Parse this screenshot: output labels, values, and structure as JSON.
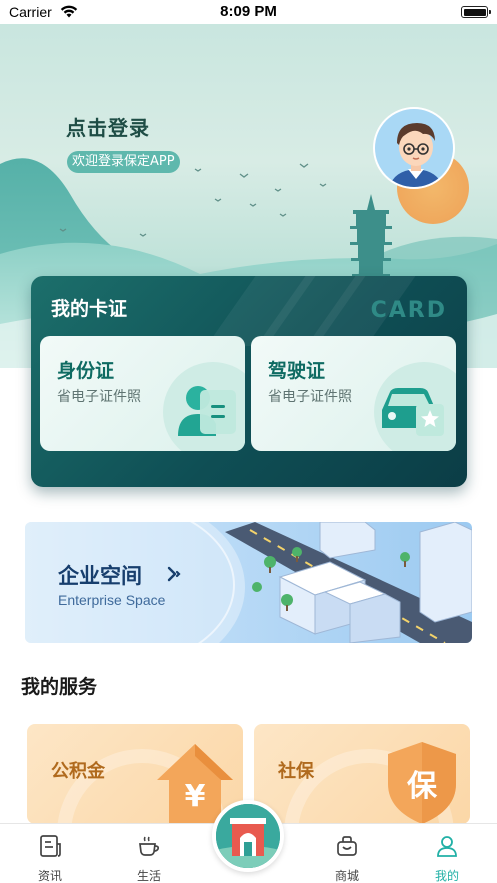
{
  "status_bar": {
    "carrier": "Carrier",
    "time": "8:09 PM"
  },
  "header": {
    "login_title": "点击登录",
    "welcome_text": "欢迎登录保定APP"
  },
  "cards": {
    "section_title": "我的卡证",
    "watermark": "CARD",
    "items": [
      {
        "title": "身份证",
        "subtitle": "省电子证件照",
        "icon": "id-card-icon"
      },
      {
        "title": "驾驶证",
        "subtitle": "省电子证件照",
        "icon": "car-license-icon"
      }
    ]
  },
  "enterprise": {
    "title": "企业空间",
    "subtitle": "Enterprise Space",
    "arrow": "›"
  },
  "services": {
    "section_title": "我的服务",
    "items": [
      {
        "title": "公积金",
        "icon": "housing-fund-icon",
        "glyph": "¥"
      },
      {
        "title": "社保",
        "icon": "social-security-icon",
        "glyph": "保"
      }
    ]
  },
  "tabbar": {
    "items": [
      {
        "label": "资讯",
        "icon": "news-icon"
      },
      {
        "label": "生活",
        "icon": "coffee-cup-icon"
      },
      {
        "label": "",
        "icon": "city-gate-icon"
      },
      {
        "label": "商城",
        "icon": "shop-bag-icon"
      },
      {
        "label": "我的",
        "icon": "user-icon",
        "active": true
      }
    ]
  },
  "colors": {
    "accent": "#21b0a6",
    "card_panel": "#0f4f55",
    "service_orange": "#f3a65a"
  }
}
